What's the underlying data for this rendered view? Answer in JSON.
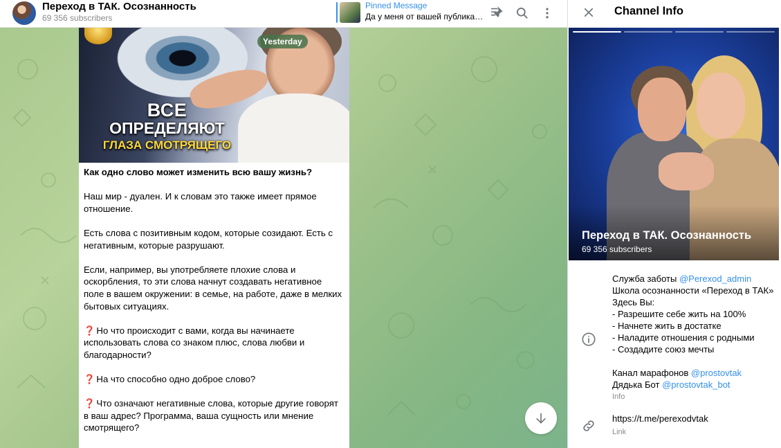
{
  "header": {
    "title": "Переход в ТАК. Осознанность",
    "subscribers": "69 356 subscribers",
    "pinned_title": "Pinned Message",
    "pinned_text": "Да у меня от вашей публикации..."
  },
  "message": {
    "date_badge": "Yesterday",
    "image_line1": "ВСЕ",
    "image_line2": "ОПРЕДЕЛЯЮТ",
    "image_line3": "ГЛАЗА СМОТРЯЩЕГО",
    "paragraphs": [
      "Как одно слово может изменить всю вашу жизнь?",
      "Наш мир - дуален. И к словам это также имеет прямое отношение.",
      "Есть слова с позитивным кодом, которые созидают. Есть с негативным, которые разрушают.",
      "Если, например, вы употребляете плохие слова и оскорбления, то эти слова начнут создавать негативное поле в вашем окружении: в семье, на работе, даже в мелких бытовых ситуациях."
    ],
    "question_mark": "❓",
    "questions": [
      "Но что происходит с вами, когда вы начинаете использовать слова со знаком плюс, слова любви и благодарности?",
      "На что способно одно доброе слово?",
      "Что означают негативные слова, которые другие говорят в ваш адрес? Программа, ваша сущность или мнение смотрящего?"
    ]
  },
  "panel": {
    "title": "Channel Info",
    "channel_name": "Переход в ТАК. Осознанность",
    "channel_subs": "69 356 subscribers",
    "info": {
      "line1_prefix": "Служба заботы ",
      "line1_mention": "@Perexod_admin",
      "line2": "Школа осознанности «Переход в ТАК»",
      "line3": "Здесь Вы:",
      "bullets": [
        " - Разрешите себе жить на 100%",
        " - Начнете жить в достатке",
        " - Наладите отношения с родными",
        " - Создадите союз мечты"
      ],
      "marathon_prefix": "Канал марафонов ",
      "marathon_mention": "@prostovtak",
      "bot_prefix": "Дядька Бот ",
      "bot_mention": "@prostovtak_bot",
      "caption": "Info"
    },
    "link": {
      "url": "https://t.me/perexodvtak",
      "caption": "Link"
    }
  },
  "colors": {
    "accent": "#3390ec",
    "question_mark": "#d62b2b",
    "chat_bg": "#a9c98f"
  },
  "icons": [
    "unpin-icon",
    "search-icon",
    "more-vertical-icon",
    "close-icon",
    "info-icon",
    "link-icon",
    "arrow-down-icon"
  ]
}
